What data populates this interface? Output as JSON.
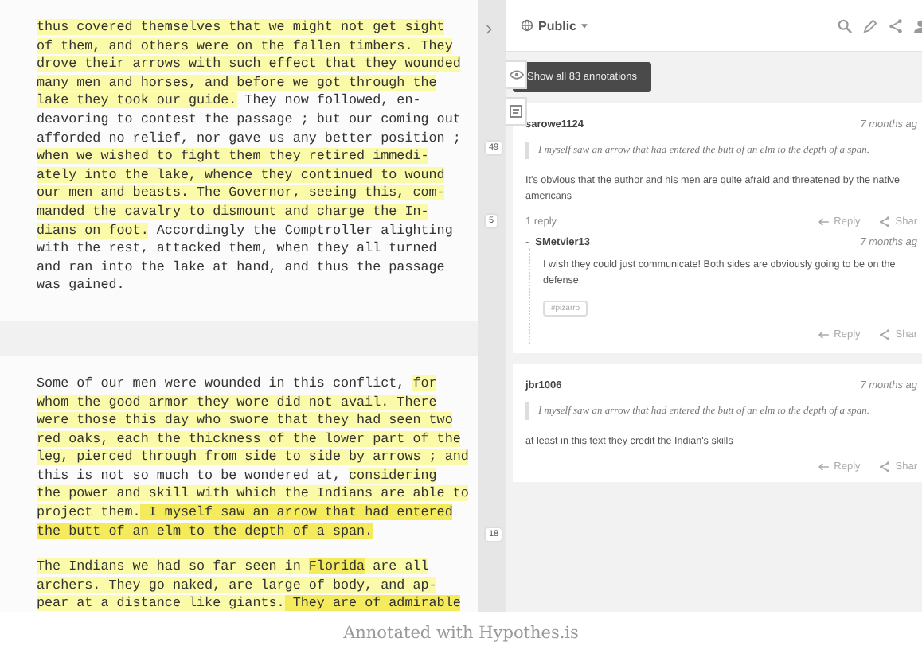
{
  "document": {
    "blocks": [
      {
        "paragraphs": [
          {
            "lines": [
              [
                {
                  "text": "thus covered themselves that we might not get sight",
                  "highlighted": true,
                  "focused": false
                }
              ],
              [
                {
                  "text": "of them, and others were on the fallen timbers. They",
                  "highlighted": true,
                  "focused": false
                }
              ],
              [
                {
                  "text": "drove their arrows with such effect that they wounded",
                  "highlighted": true,
                  "focused": false
                }
              ],
              [
                {
                  "text": "many men and horses, and before we got through the",
                  "highlighted": true,
                  "focused": false
                }
              ],
              [
                {
                  "text": "lake they took our guide.",
                  "highlighted": true,
                  "focused": false
                },
                {
                  "text": " They now followed, en-",
                  "highlighted": false,
                  "focused": false
                }
              ],
              [
                {
                  "text": "deavoring to contest the passage ; but our coming out",
                  "highlighted": false,
                  "focused": false
                }
              ],
              [
                {
                  "text": "afforded no relief, nor gave us any better position ;",
                  "highlighted": false,
                  "focused": false
                }
              ],
              [
                {
                  "text": "when we wished to fight them they retired immedi-",
                  "highlighted": true,
                  "focused": false
                }
              ],
              [
                {
                  "text": "ately into the lake, whence they continued to wound",
                  "highlighted": true,
                  "focused": false
                }
              ],
              [
                {
                  "text": "our men and beasts. The Governor, seeing this, com-",
                  "highlighted": true,
                  "focused": false
                }
              ],
              [
                {
                  "text": "manded the cavalry to dismount and charge the In-",
                  "highlighted": true,
                  "focused": false
                }
              ],
              [
                {
                  "text": "dians on foot.",
                  "highlighted": true,
                  "focused": false
                },
                {
                  "text": " Accordingly the Comptroller alighting",
                  "highlighted": false,
                  "focused": false
                }
              ],
              [
                {
                  "text": "with the rest, attacked them, when they all turned",
                  "highlighted": false,
                  "focused": false
                }
              ],
              [
                {
                  "text": "and ran into the lake at hand, and thus the passage",
                  "highlighted": false,
                  "focused": false
                }
              ],
              [
                {
                  "text": "was gained.",
                  "highlighted": false,
                  "focused": false
                }
              ]
            ]
          }
        ]
      },
      {
        "paragraphs": [
          {
            "lines": [
              [
                {
                  "text": "Some of our men were wounded in this conflict, ",
                  "highlighted": false,
                  "focused": false
                },
                {
                  "text": "for",
                  "highlighted": true,
                  "focused": false
                }
              ],
              [
                {
                  "text": "whom the good armor they wore did not avail. There",
                  "highlighted": true,
                  "focused": false
                }
              ],
              [
                {
                  "text": "were those this day who swore that they had seen two",
                  "highlighted": true,
                  "focused": false
                }
              ],
              [
                {
                  "text": "red oaks, each the thickness of the lower part of the",
                  "highlighted": true,
                  "focused": false
                }
              ],
              [
                {
                  "text": "leg, pierced through from side to side by arrows ; and",
                  "highlighted": true,
                  "focused": false
                }
              ],
              [
                {
                  "text": "this is not so much to be wondered at, ",
                  "highlighted": false,
                  "focused": false
                },
                {
                  "text": "considering",
                  "highlighted": true,
                  "focused": false
                }
              ],
              [
                {
                  "text": "the power and skill with which the Indians are able to",
                  "highlighted": true,
                  "focused": false
                }
              ],
              [
                {
                  "text": "project them.",
                  "highlighted": true,
                  "focused": false
                },
                {
                  "text": " I myself saw an arrow that had entered",
                  "highlighted": true,
                  "focused": true
                }
              ],
              [
                {
                  "text": "the butt of an elm to the depth of a span.",
                  "highlighted": true,
                  "focused": true
                }
              ]
            ]
          },
          {
            "lines": [
              [
                {
                  "text": "The Indians we had so far seen in ",
                  "highlighted": true,
                  "focused": false
                },
                {
                  "text": "Florida",
                  "highlighted": true,
                  "focused": true
                },
                {
                  "text": " are all",
                  "highlighted": true,
                  "focused": false
                }
              ],
              [
                {
                  "text": "archers. They go naked, are large of body, and ap-",
                  "highlighted": true,
                  "focused": false
                }
              ],
              [
                {
                  "text": "pear at a distance like giants.",
                  "highlighted": true,
                  "focused": false
                },
                {
                  "text": " They are of admirable",
                  "highlighted": true,
                  "focused": true
                }
              ]
            ]
          }
        ]
      }
    ]
  },
  "gutter": {
    "bubbles": [
      {
        "count": "49"
      },
      {
        "count": "5"
      },
      {
        "count": "18"
      }
    ]
  },
  "panel": {
    "group": "Public",
    "show_all_button": "Show all 83 annotations",
    "annotations": [
      {
        "user": "sarowe1124",
        "time": "7 months ag",
        "quote": "I myself saw an arrow that had entered the butt of an elm to the depth of a span.",
        "text": "It's obvious that the author and his men are quite afraid and threatened by the native americans",
        "reply_count": "1 reply",
        "actions": [
          "Reply",
          "Shar"
        ],
        "replies": [
          {
            "toggle": "-",
            "user": "SMetvier13",
            "time": "7 months ag",
            "text": "I wish they could just communicate! Both sides are obviously going to be on the defense.",
            "tag": "#pizarro",
            "actions": [
              "Reply",
              "Shar"
            ]
          }
        ]
      },
      {
        "user": "jbr1006",
        "time": "7 months ag",
        "quote": "I myself saw an arrow that had entered the butt of an elm to the depth of a span.",
        "text": "at least in this text they credit the Indian's skills",
        "actions": [
          "Reply",
          "Shar"
        ]
      }
    ]
  },
  "caption": "Annotated with Hypothes.is"
}
